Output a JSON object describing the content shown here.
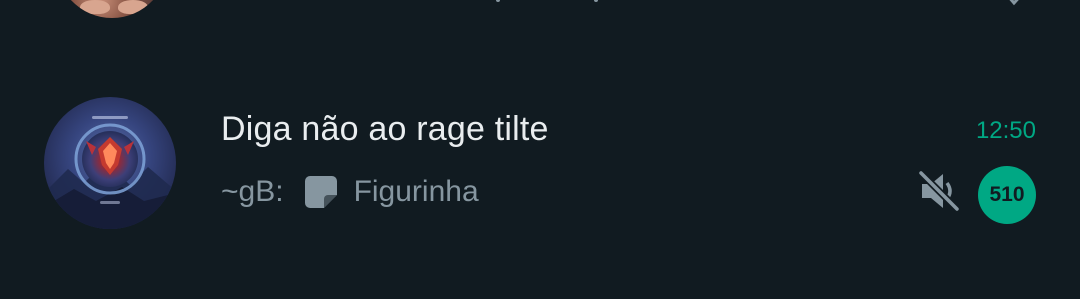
{
  "chat": {
    "title": "Diga não ao rage tilte",
    "time": "12:50",
    "preview": {
      "sender": "~gB:",
      "message_icon": "sticker-icon",
      "message": "Figurinha"
    },
    "muted_icon": "speaker-muted-icon",
    "unread_count": "510",
    "avatar_icon": "group-avatar"
  },
  "colors": {
    "background": "#111b21",
    "title_text": "#e9edef",
    "secondary_text": "#8696a0",
    "accent": "#00a884"
  }
}
